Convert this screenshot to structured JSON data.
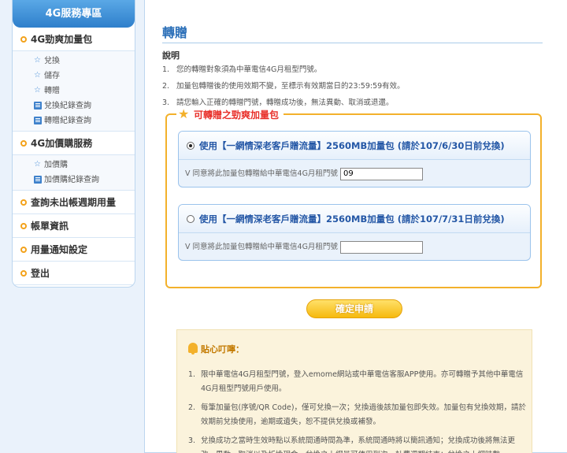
{
  "sidebar": {
    "header": "4G服務專區",
    "groups": [
      {
        "label": "4G勁爽加量包",
        "subitems": [
          {
            "label": "兌換",
            "icon": "star-icon"
          },
          {
            "label": "儲存",
            "icon": "star-icon"
          },
          {
            "label": "轉贈",
            "icon": "star-icon"
          },
          {
            "label": "兌換紀錄查詢",
            "icon": "document-icon"
          },
          {
            "label": "轉贈紀錄查詢",
            "icon": "document-icon"
          }
        ]
      },
      {
        "label": "4G加價購服務",
        "subitems": [
          {
            "label": "加價購",
            "icon": "star-icon"
          },
          {
            "label": "加價購紀錄查詢",
            "icon": "document-icon"
          }
        ]
      },
      {
        "label": "查詢未出帳週期用量"
      },
      {
        "label": "帳單資訊"
      },
      {
        "label": "用量通知設定"
      },
      {
        "label": "登出"
      }
    ]
  },
  "main": {
    "title": "轉贈",
    "desc_title": "說明",
    "desc": [
      {
        "n": "1.",
        "text": "您的轉贈對象須為中華電信4G月租型門號。"
      },
      {
        "n": "2.",
        "text": "加量包轉贈後的使用效期不變，至標示有效期當日的23:59:59有效。"
      },
      {
        "n": "3.",
        "text": "請您輸入正確的轉贈門號，轉贈成功後，無法異動、取消或退還。"
      }
    ],
    "gift_title": "可轉贈之勁爽加量包",
    "options": [
      {
        "label": "使用【一網情深老客戶贈流量】2560MB加量包 (請於107/6/30日前兌換)",
        "checked": true,
        "prompt": "V 同意將此加量包轉贈給中華電信4G月租門號",
        "value": "09"
      },
      {
        "label": "使用【一網情深老客戶贈流量】2560MB加量包 (請於107/7/31日前兌換)",
        "checked": false,
        "prompt": "V 同意將此加量包轉贈給中華電信4G月租門號",
        "value": ""
      }
    ],
    "submit_label": "確定申請",
    "notice_title": "貼心叮嚀：",
    "notices": [
      {
        "n": "1.",
        "text": "限中華電信4G月租型門號，登入emome網站或中華電信客服APP使用。亦可轉贈予其他中華電信4G月租型門號用戶使用。"
      },
      {
        "n": "2.",
        "text": "每筆加量包(序號/QR Code)，僅可兌換一次；兌換過後該加量包即失效。加量包有兌換效期，請於效期前兌換使用，逾期或遺失，恕不提供兌換或補發。"
      },
      {
        "n": "3.",
        "text": "兌換成功之當時生效時點以系統間通時間為準，系統間通時將以簡訊通知；兌換成功後將無法更改、異動、取消以及折換現金。兌換之上網量可使用到次一計費週期結束；兌換之上網時數"
      }
    ]
  }
}
